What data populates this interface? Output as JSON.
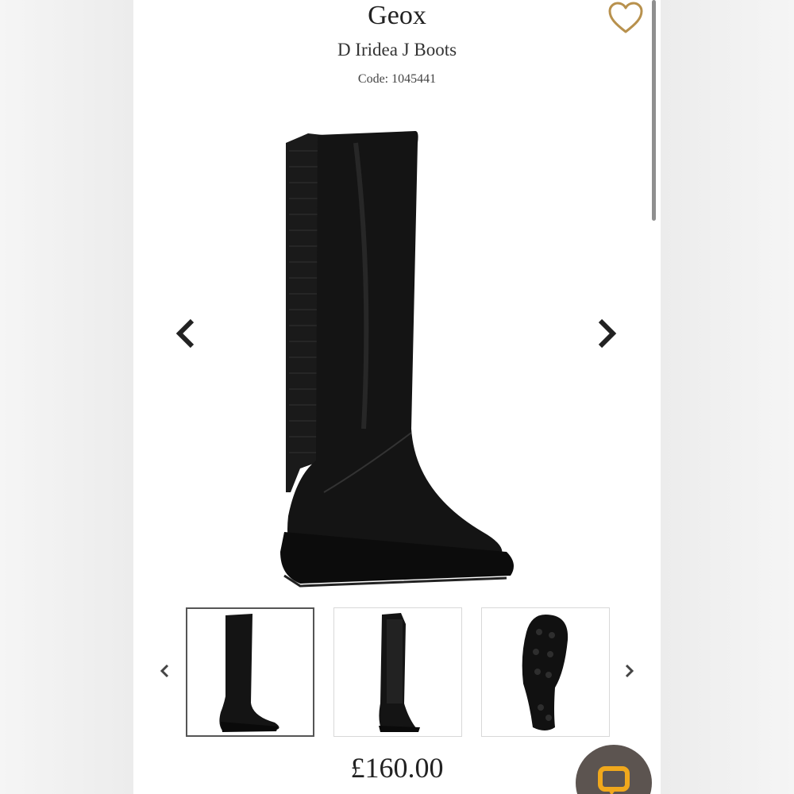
{
  "product": {
    "brand": "Geox",
    "name": "D Iridea J Boots",
    "code": "Code: 1045441",
    "price": "£160.00"
  },
  "icons": {
    "wishlist": "heart-outline-icon",
    "prev": "chevron-left-icon",
    "next": "chevron-right-icon",
    "chat": "chat-bubble-icon"
  },
  "colors": {
    "accent_gold": "#b8914d",
    "text": "#222222",
    "chat_bg": "#5c5450",
    "chat_icon": "#f0a81c"
  },
  "gallery": {
    "thumbnails": [
      {
        "view": "side",
        "selected": true
      },
      {
        "view": "back",
        "selected": false
      },
      {
        "view": "sole",
        "selected": false
      }
    ]
  }
}
